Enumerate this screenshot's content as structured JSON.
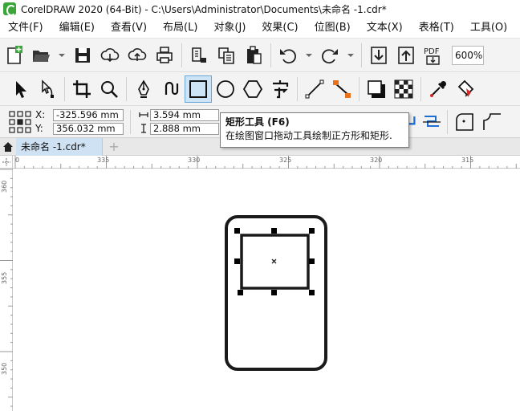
{
  "window": {
    "title": "CorelDRAW 2020 (64-Bit) - C:\\Users\\Administrator\\Documents\\未命名 -1.cdr*"
  },
  "menu": [
    {
      "label": "文件(F)"
    },
    {
      "label": "编辑(E)"
    },
    {
      "label": "查看(V)"
    },
    {
      "label": "布局(L)"
    },
    {
      "label": "对象(J)"
    },
    {
      "label": "效果(C)"
    },
    {
      "label": "位图(B)"
    },
    {
      "label": "文本(X)"
    },
    {
      "label": "表格(T)"
    },
    {
      "label": "工具(O)"
    }
  ],
  "standard_toolbar": {
    "zoom": "600%",
    "pdf_label": "PDF"
  },
  "toolbox_icons": [
    "pick-tool-icon",
    "shape-tool-icon",
    "crop-tool-icon",
    "zoom-tool-icon",
    "pen-tool-icon",
    "artistic-media-icon",
    "rectangle-tool-icon",
    "ellipse-tool-icon",
    "polygon-tool-icon",
    "text-tool-icon",
    "line-tool-icon",
    "connector-tool-icon",
    "drop-shadow-icon",
    "transparency-icon",
    "eyedropper-icon",
    "fill-tool-icon"
  ],
  "property_bar": {
    "x_label": "X:",
    "y_label": "Y:",
    "x_value": "-325.596 mm",
    "y_value": "356.032 mm",
    "width_value": "3.594 mm",
    "height_value": "2.888 mm"
  },
  "tooltip": {
    "title": "矩形工具 (F6)",
    "description": "在绘图窗口拖动工具绘制正方形和矩形."
  },
  "tabs": {
    "document": "未命名 -1.cdr*",
    "add": "+"
  },
  "rulers": {
    "horizontal": [
      "0",
      "335",
      "330",
      "325",
      "320",
      "315"
    ],
    "vertical": [
      "360",
      "355",
      "350"
    ]
  },
  "colors": {
    "accent": "#cde4f7",
    "selection_handle": "#000000",
    "shape_stroke": "#1a1a1a",
    "connector_orange": "#e8711c",
    "fill_red": "#d62828",
    "contour_blue": "#1e6fd0"
  }
}
